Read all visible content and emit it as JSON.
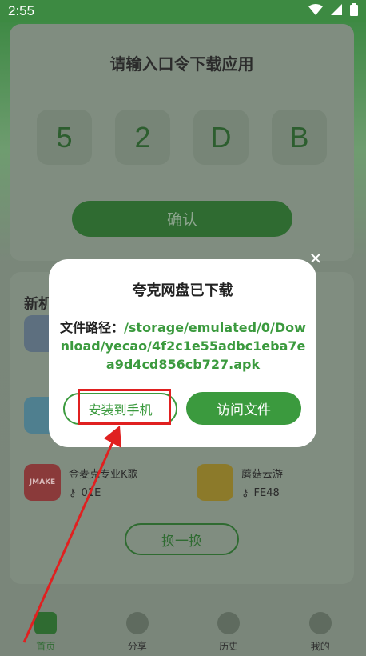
{
  "status_bar": {
    "time": "2:55"
  },
  "main_card": {
    "title": "请输入口令下载应用",
    "code_chars": [
      "5",
      "2",
      "D",
      "B"
    ],
    "confirm_label": "确认"
  },
  "list_card": {
    "title_partial": "新机",
    "apps": [
      {
        "name": "金麦克专业K歌",
        "code": "01E",
        "icon_text": "JMAKE"
      },
      {
        "name": "蘑菇云游",
        "code": "FE48",
        "icon_text": ""
      }
    ],
    "swap_label": "换一换"
  },
  "bottom_nav": {
    "items": [
      {
        "label": "首页",
        "active": true
      },
      {
        "label": "分享",
        "active": false
      },
      {
        "label": "历史",
        "active": false
      },
      {
        "label": "我的",
        "active": false
      }
    ]
  },
  "dialog": {
    "title": "夸克网盘已下载",
    "path_label": "文件路径：",
    "path_value": "/storage/emulated/0/Download/yecao/4f2c1e55adbc1eba7ea9d4cd856cb727.apk",
    "install_label": "安装到手机",
    "visit_label": "访问文件"
  },
  "colors": {
    "accent": "#3b9a3e",
    "status_bar": "#3d8a42",
    "annotation": "#e02020"
  }
}
